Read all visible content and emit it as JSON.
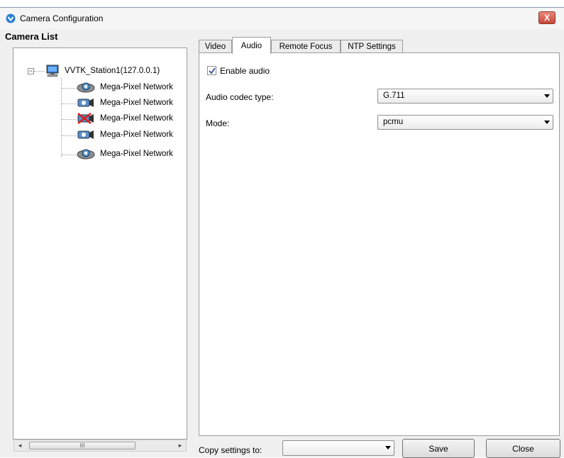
{
  "window": {
    "title": "Camera Configuration",
    "close_label": "X"
  },
  "camera_list": {
    "title": "Camera List",
    "station": {
      "label": "VVTK_Station1(127.0.0.1)",
      "expander": "−"
    },
    "cameras": [
      {
        "label": "Mega-Pixel Network",
        "icon": "dome-camera-icon"
      },
      {
        "label": "Mega-Pixel Network",
        "icon": "box-camera-icon"
      },
      {
        "label": "Mega-Pixel Network",
        "icon": "disconnected-camera-icon"
      },
      {
        "label": "Mega-Pixel Network",
        "icon": "box-camera-icon"
      },
      {
        "label": "Mega-Pixel Network",
        "icon": "dome-camera-icon"
      }
    ],
    "scrollbar": {
      "left_arrow": "◂",
      "right_arrow": "▸",
      "thumb_grip": "III"
    }
  },
  "tabs": [
    "Video",
    "Audio",
    "Remote Focus",
    "NTP Settings"
  ],
  "active_tab": "Audio",
  "audio": {
    "enable_label": "Enable audio",
    "enable_checked": true,
    "codec_label": "Audio codec type:",
    "codec_value": "G.711",
    "mode_label": "Mode:",
    "mode_value": "pcmu"
  },
  "footer": {
    "copy_label": "Copy settings to:",
    "copy_value": "",
    "save_label": "Save",
    "close_label": "Close"
  },
  "colors": {
    "accent": "#2a7fd4",
    "close_red": "#c94a3a"
  }
}
